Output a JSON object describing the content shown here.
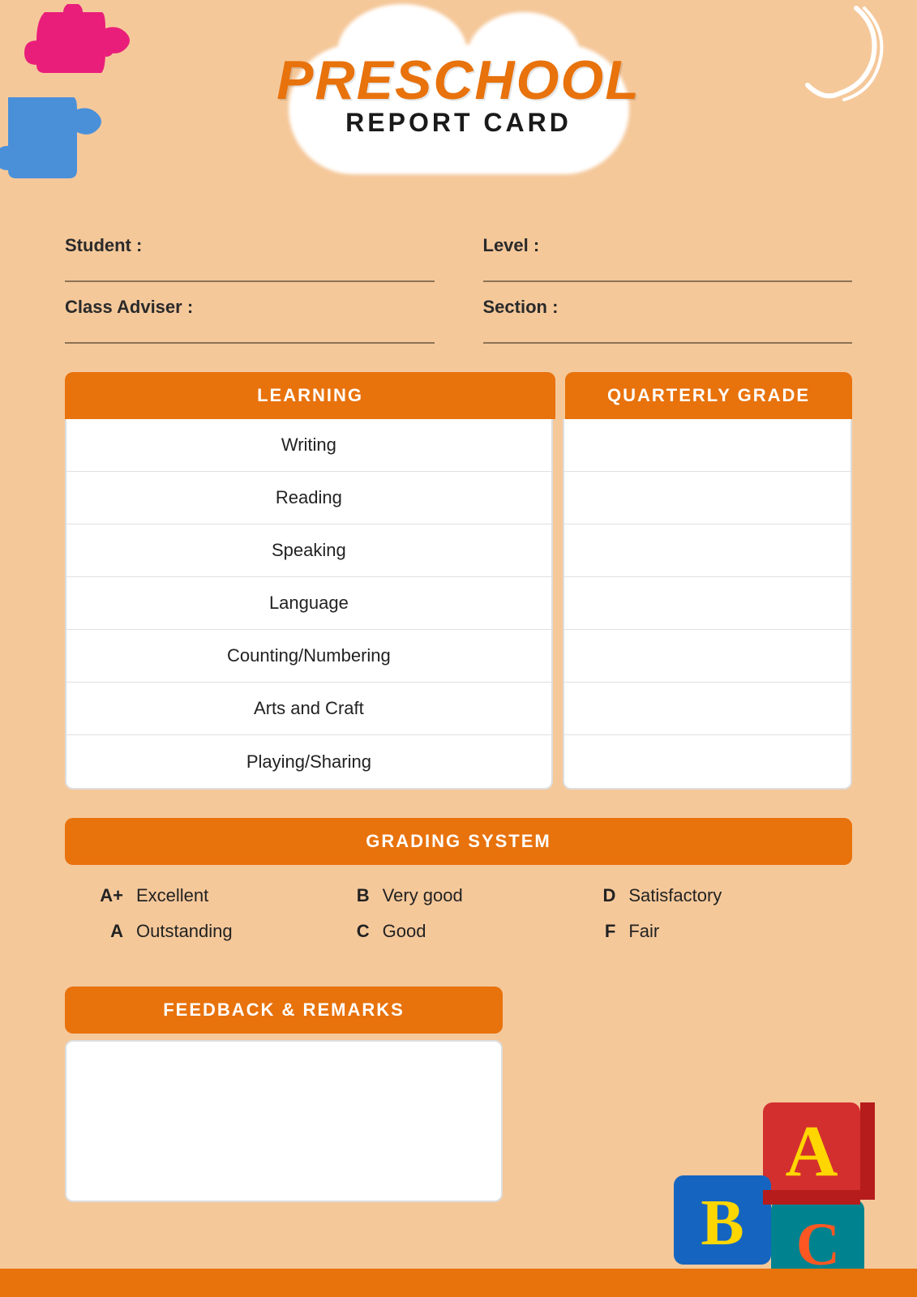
{
  "title": {
    "preschool": "PRESCHOOL",
    "reportCard": "REPORT CARD"
  },
  "form": {
    "student_label": "Student :",
    "level_label": "Level :",
    "class_adviser_label": "Class Adviser :",
    "section_label": "Section :"
  },
  "table": {
    "learning_header": "LEARNING",
    "grade_header": "QUARTERLY GRADE",
    "subjects": [
      "Writing",
      "Reading",
      "Speaking",
      "Language",
      "Counting/Numbering",
      "Arts and Craft",
      "Playing/Sharing"
    ]
  },
  "grading": {
    "header": "GRADING SYSTEM",
    "items": [
      {
        "letter": "A+",
        "desc": "Excellent"
      },
      {
        "letter": "A",
        "desc": "Outstanding"
      },
      {
        "letter": "B",
        "desc": "Very good"
      },
      {
        "letter": "C",
        "desc": "Good"
      },
      {
        "letter": "D",
        "desc": "Satisfactory"
      },
      {
        "letter": "F",
        "desc": "Fair"
      }
    ]
  },
  "feedback": {
    "header": "FEEDBACK & REMARKS"
  },
  "colors": {
    "orange": "#E8720C",
    "background": "#F5C89A",
    "pink_puzzle": "#E91E7A",
    "blue_puzzle": "#4A90D9"
  }
}
